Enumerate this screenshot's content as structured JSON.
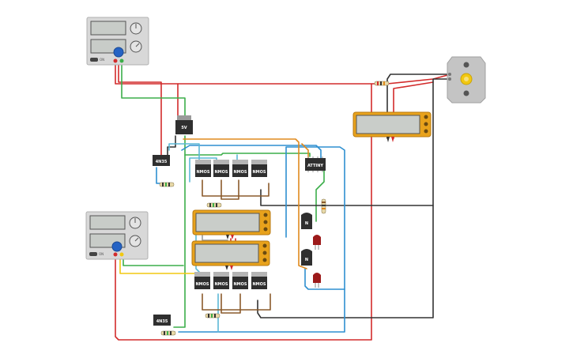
{
  "colors": {
    "red": "#d22b2b",
    "green": "#3cae4a",
    "black": "#333333",
    "blue": "#2e8fd0",
    "orange": "#e08a1e",
    "yellow": "#f2c811",
    "brown": "#8a5a2b",
    "cyan": "#5bb8d6",
    "psu_body": "#d8d8d8",
    "meter_body": "#e8a21c",
    "chip_body": "#3a3a3a"
  },
  "regulator": {
    "label": "5V"
  },
  "optocouplers": [
    {
      "label": "4N35"
    },
    {
      "label": "4N35"
    }
  ],
  "mosfets_top": [
    {
      "label": "NMOS"
    },
    {
      "label": "NMOS"
    },
    {
      "label": "NMOS"
    },
    {
      "label": "NMOS"
    }
  ],
  "mosfets_bottom": [
    {
      "label": "NMOS"
    },
    {
      "label": "NMOS"
    },
    {
      "label": "NMOS"
    },
    {
      "label": "NMOS"
    }
  ],
  "mcu": {
    "label": "ATTINY"
  },
  "transistors": [
    {
      "label": "N"
    },
    {
      "label": "N"
    }
  ],
  "power_supplies": [
    {
      "name": "power-supply-top",
      "toggle": "ON"
    },
    {
      "name": "power-supply-bottom",
      "toggle": "ON"
    }
  ]
}
